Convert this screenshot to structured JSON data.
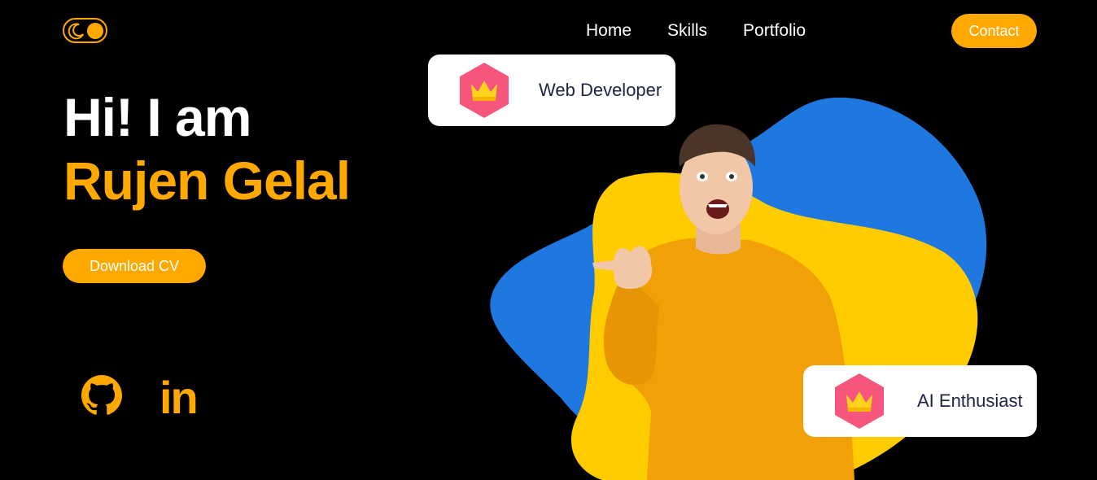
{
  "header": {
    "theme_toggle_icon": "moon-icon",
    "nav": [
      {
        "label": "Home"
      },
      {
        "label": "Skills"
      },
      {
        "label": "Portfolio"
      }
    ],
    "contact_label": "Contact"
  },
  "hero": {
    "greeting": "Hi! I am",
    "name": "Rujen Gelal",
    "cv_label": "Download CV"
  },
  "social": {
    "github_icon": "github-icon",
    "linkedin_text": "in"
  },
  "cards": {
    "web": {
      "label": "Web Developer",
      "icon": "crown-icon"
    },
    "ai": {
      "label": "AI Enthusiast",
      "icon": "crown-icon"
    }
  },
  "colors": {
    "accent": "#ffa800",
    "background": "#000000",
    "blob_blue": "#1e78e0",
    "blob_yellow": "#ffcc00",
    "badge_pink": "#f7567c",
    "card_text": "#1e2247"
  }
}
